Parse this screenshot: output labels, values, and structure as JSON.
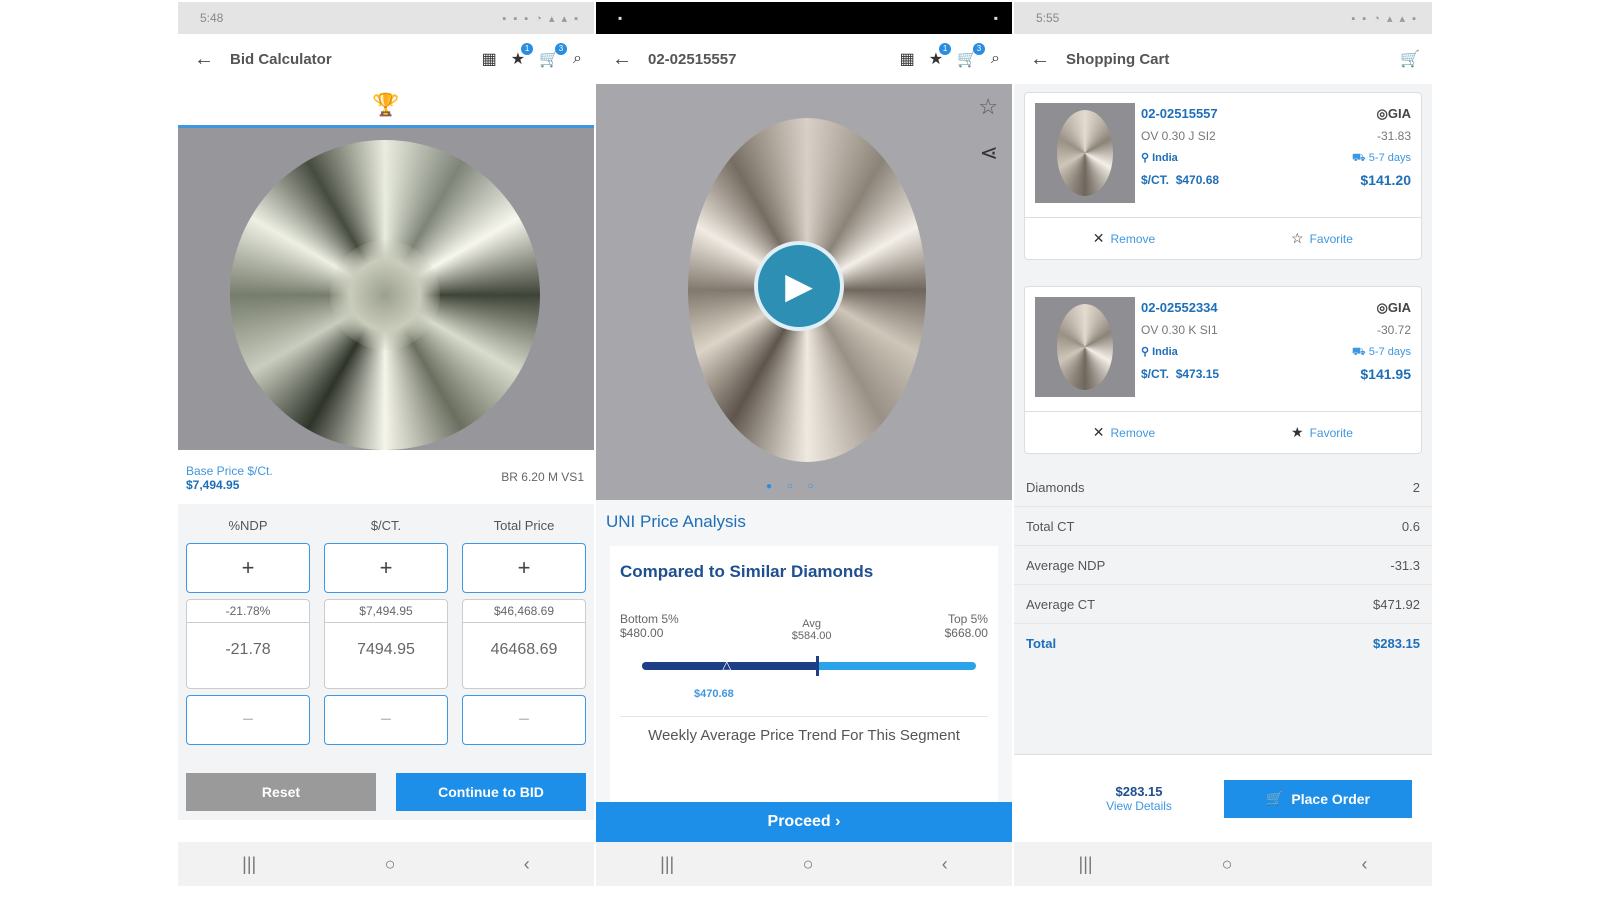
{
  "screen1": {
    "status": {
      "time": "5:48",
      "icons": "▪ ▪ ▪ ◔ ▴ ▴ ▪"
    },
    "toolbar": {
      "title": "Bid Calculator",
      "fav_badge": "1",
      "cart_badge": "3"
    },
    "base_price_label": "Base Price $/Ct.",
    "base_price_value": "$7,494.95",
    "stone_desc": "BR 6.20 M VS1",
    "columns": [
      {
        "header": "%NDP",
        "plus": "+",
        "small": "-21.78%",
        "big": "-21.78",
        "minus": "−"
      },
      {
        "header": "$/CT.",
        "plus": "+",
        "small": "$7,494.95",
        "big": "7494.95",
        "minus": "−"
      },
      {
        "header": "Total Price",
        "plus": "+",
        "small": "$46,468.69",
        "big": "46468.69",
        "minus": "−"
      }
    ],
    "reset_label": "Reset",
    "continue_label": "Continue to BID"
  },
  "screen2": {
    "toolbar": {
      "title": "02-02515557",
      "fav_badge": "1",
      "cart_badge": "3"
    },
    "uni_title": "UNI Price Analysis",
    "card_title": "Compared to Similar Diamonds",
    "bottom_label": "Bottom 5%",
    "bottom_value": "$480.00",
    "avg_label": "Avg",
    "avg_value": "$584.00",
    "top_label": "Top 5%",
    "top_value": "$668.00",
    "your_price": "$470.68",
    "weekly_label": "Weekly Average Price Trend For This Segment",
    "proceed_label": "Proceed  ›"
  },
  "screen3": {
    "status": {
      "time": "5:55",
      "icons": "▪ ▪ ◔ ▴ ▴ ▪"
    },
    "toolbar": {
      "title": "Shopping Cart"
    },
    "items": [
      {
        "sku": "02-02515557",
        "desc": "OV 0.30 J SI2",
        "origin": "India",
        "pct_label": "$/CT.",
        "pct_value": "$470.68",
        "lab": "GIA",
        "ndp": "-31.83",
        "ship": "5-7 days",
        "total": "$141.20",
        "remove": "Remove",
        "favorite": "Favorite",
        "fav_icon": "☆"
      },
      {
        "sku": "02-02552334",
        "desc": "OV 0.30 K SI1",
        "origin": "India",
        "pct_label": "$/CT.",
        "pct_value": "$473.15",
        "lab": "GIA",
        "ndp": "-30.72",
        "ship": "5-7 days",
        "total": "$141.95",
        "remove": "Remove",
        "favorite": "Favorite",
        "fav_icon": "★"
      }
    ],
    "summary": [
      {
        "label": "Diamonds",
        "value": "2"
      },
      {
        "label": "Total CT",
        "value": "0.6"
      },
      {
        "label": "Average NDP",
        "value": "-31.3"
      },
      {
        "label": "Average CT",
        "value": "$471.92"
      }
    ],
    "total_label": "Total",
    "total_value": "$283.15",
    "order_amount": "$283.15",
    "view_details": "View Details",
    "place_order": "Place Order"
  }
}
